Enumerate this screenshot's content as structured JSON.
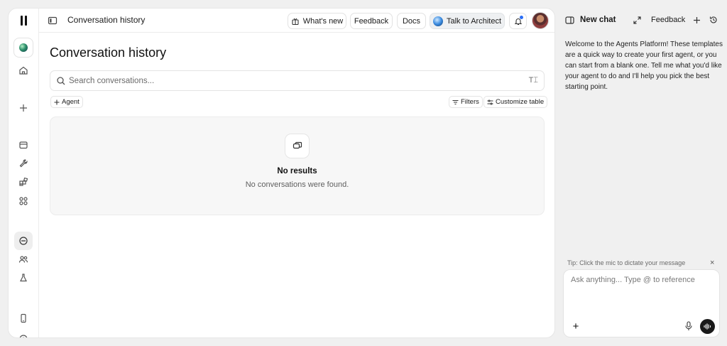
{
  "header": {
    "title": "Conversation history",
    "buttons": {
      "whats_new": "What's new",
      "feedback": "Feedback",
      "docs": "Docs",
      "talk_to_architect": "Talk to Architect"
    }
  },
  "main": {
    "title": "Conversation history",
    "search": {
      "placeholder": "Search conversations..."
    },
    "filters": {
      "agent_chip": "Agent",
      "filters_label": "Filters",
      "customize_label": "Customize table"
    },
    "empty_state": {
      "title": "No results",
      "subtitle": "No conversations were found."
    }
  },
  "chat_panel": {
    "title": "New chat",
    "feedback_label": "Feedback",
    "welcome": "Welcome to the Agents Platform! These templates are a quick way to create your first agent, or you can start from a blank one. Tell me what you'd like your agent to do and I'll help you pick the best starting point.",
    "tip": "Tip: Click the mic to dictate your message",
    "input_placeholder": "Ask anything... Type @ to reference"
  },
  "colors": {
    "accent_notification": "#2a6df5",
    "voice_button": "#1a1a1a",
    "app_background": "#f0f0f0"
  }
}
